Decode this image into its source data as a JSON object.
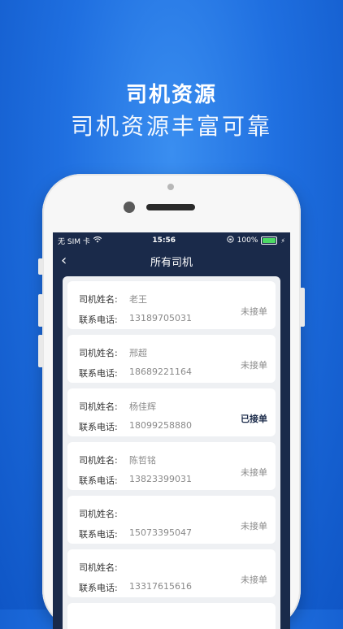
{
  "promo": {
    "title": "司机资源",
    "subtitle": "司机资源丰富可靠"
  },
  "statusbar": {
    "carrier": "无 SIM 卡",
    "time": "15:56",
    "battery": "100%"
  },
  "nav": {
    "title": "所有司机"
  },
  "labels": {
    "name": "司机姓名:",
    "phone": "联系电话:"
  },
  "drivers": [
    {
      "name": "老王",
      "phone": "13189705031",
      "status": "未接单",
      "accepted": false
    },
    {
      "name": "邢超",
      "phone": "18689221164",
      "status": "未接单",
      "accepted": false
    },
    {
      "name": "杨佳辉",
      "phone": "18099258880",
      "status": "已接单",
      "accepted": true
    },
    {
      "name": "陈哲铭",
      "phone": "13823399031",
      "status": "未接单",
      "accepted": false
    },
    {
      "name": "",
      "phone": "15073395047",
      "status": "未接单",
      "accepted": false
    },
    {
      "name": "",
      "phone": "13317615616",
      "status": "未接单",
      "accepted": false
    }
  ]
}
